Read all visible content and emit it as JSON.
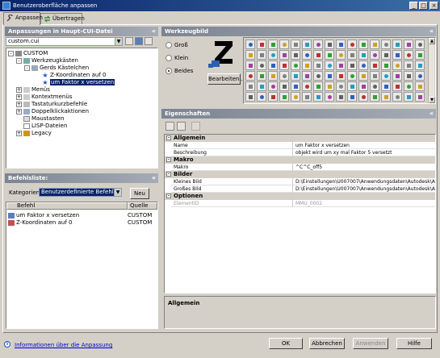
{
  "window": {
    "title": "Benutzeroberfläche anpassen",
    "minimize": "_",
    "maximize": "□",
    "close": "×"
  },
  "tabs": [
    {
      "label": "Anpassen"
    },
    {
      "label": "Übertragen"
    }
  ],
  "left_panel": {
    "header": "Anpassungen in Haupt-CUI-Datei",
    "file_combo": "custom.cui",
    "tree": [
      {
        "label": "CUSTOM",
        "level": 0,
        "expander": "-"
      },
      {
        "label": "Werkzeugkästen",
        "level": 1,
        "expander": "-"
      },
      {
        "label": "Gerds Kästelchen",
        "level": 2,
        "expander": "-"
      },
      {
        "label": "Z-Koordinaten auf 0",
        "level": 3,
        "expander": ""
      },
      {
        "label": "um Faktor x versetzen",
        "level": 3,
        "expander": "",
        "selected": true
      },
      {
        "label": "Menüs",
        "level": 1,
        "expander": "+"
      },
      {
        "label": "Kontextmenüs",
        "level": 1,
        "expander": "+"
      },
      {
        "label": "Tastaturkurzbefehle",
        "level": 1,
        "expander": "+"
      },
      {
        "label": "Doppelklickaktionen",
        "level": 1,
        "expander": "+"
      },
      {
        "label": "Maustasten",
        "level": 1,
        "expander": ""
      },
      {
        "label": "LISP-Dateien",
        "level": 1,
        "expander": ""
      },
      {
        "label": "Legacy",
        "level": 1,
        "expander": "+"
      }
    ]
  },
  "command_list": {
    "header": "Befehlsliste:",
    "category_label": "Kategorien:",
    "category_value": "Benutzerdefinierte Befehle",
    "new_button": "Neu",
    "columns": [
      "Befehl",
      "Quelle"
    ],
    "rows": [
      {
        "command": "um Faktor x versetzen",
        "source": "CUSTOM"
      },
      {
        "command": "Z-Koordinaten auf 0",
        "source": "CUSTOM"
      }
    ]
  },
  "button_image": {
    "header": "Werkzeugbild",
    "options": [
      "Groß",
      "Klein",
      "Beides"
    ],
    "selected_option": "Beides",
    "edit_button": "Bearbeiten..."
  },
  "properties": {
    "header": "Eigenschaften",
    "categories": [
      {
        "name": "Allgemein",
        "rows": [
          {
            "key": "Name",
            "value": "um Faktor x versetzen"
          },
          {
            "key": "Beschreibung",
            "value": "objekt wird um xy mal Faktor 5 versetzt"
          }
        ]
      },
      {
        "name": "Makro",
        "rows": [
          {
            "key": "Makro",
            "value": "^C^C_off5"
          }
        ]
      },
      {
        "name": "Bilder",
        "rows": [
          {
            "key": "Kleines Bild",
            "value": "D:\\Einstellungen\\U007007\\Anwendungsdaten\\Autodesk\\Aut"
          },
          {
            "key": "Großes Bild",
            "value": "D:\\Einstellungen\\U007007\\Anwendungsdaten\\Autodesk\\Aut"
          }
        ]
      },
      {
        "name": "Optionen",
        "rows": [
          {
            "key": "ElementID",
            "value": "MMU_0002",
            "grayed": true
          }
        ]
      }
    ],
    "description_title": "Allgemein"
  },
  "footer": {
    "info_link": "Informationen über die Anpassung",
    "ok": "OK",
    "cancel": "Abbrechen",
    "apply": "Anwenden",
    "help": "Hilfe"
  }
}
